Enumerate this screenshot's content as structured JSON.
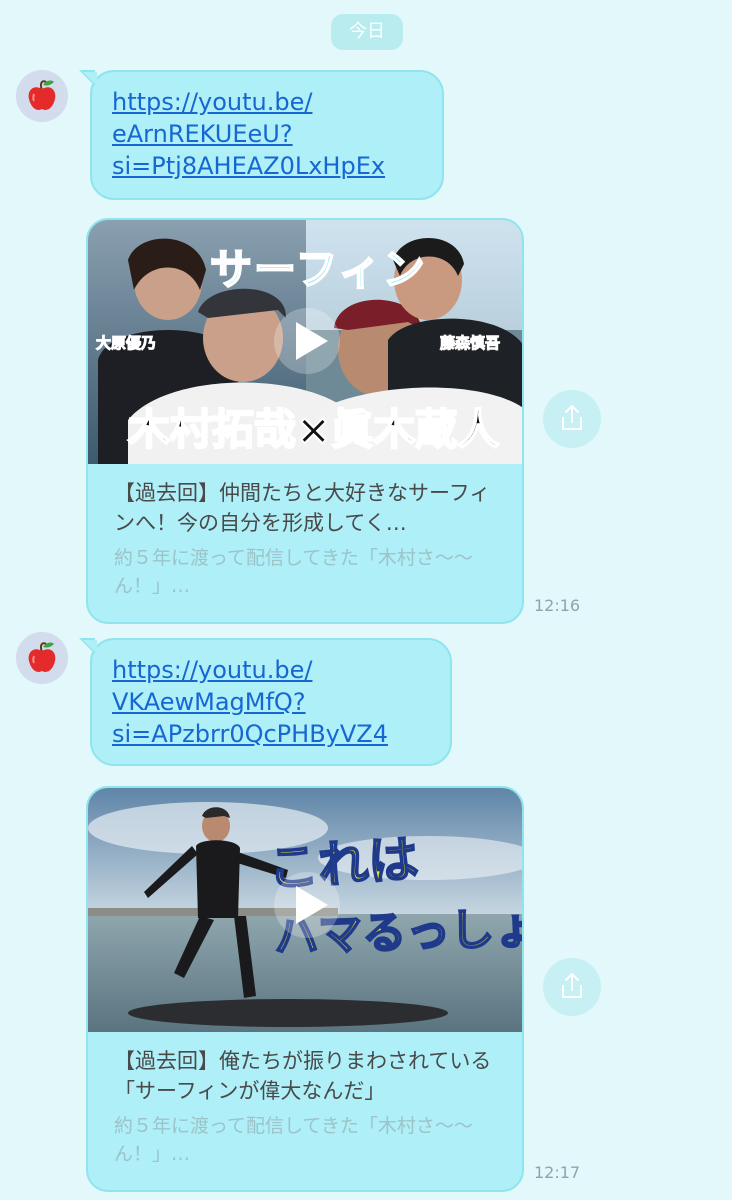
{
  "date_separator": "今日",
  "messages": [
    {
      "link_lines": [
        "https://youtu.be/",
        "eArnREKUEeU?",
        "si=Ptj8AHEAZ0LxHpEx"
      ],
      "preview": {
        "thumb_title": "サーフィン",
        "thumb_caption": "木村拓哉×眞木蔵人",
        "name_left": "大原優乃",
        "name_right": "藤森慎吾",
        "title": "【過去回】仲間たちと大好きなサーフィンへ！今の自分を形成してく…",
        "description": "約５年に渡って配信してきた「木村さ〜〜ん！」…"
      },
      "time": "12:16"
    },
    {
      "link_lines": [
        "https://youtu.be/",
        "VKAewMagMfQ?",
        "si=APzbrr0QcPHByVZ4"
      ],
      "preview": {
        "thumb_line1": "これは",
        "thumb_line2": "ハマるっしょ!",
        "title": "【過去回】俺たちが振りまわされている「サーフィンが偉大なんだ」",
        "description": "約５年に渡って配信してきた「木村さ〜〜ん！」…"
      },
      "time": "12:17"
    }
  ],
  "icons": {
    "avatar": "apple-icon",
    "play": "play-icon",
    "share": "share-icon"
  },
  "colors": {
    "background": "#e3f8fa",
    "bubble": "#aeeff8",
    "link": "#1667d2"
  }
}
